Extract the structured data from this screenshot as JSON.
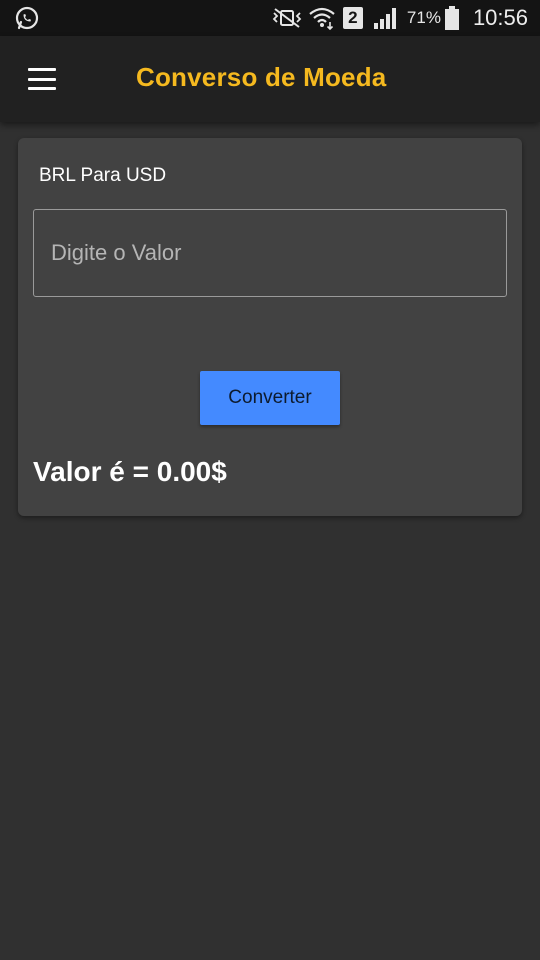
{
  "status_bar": {
    "left_icon": "whatsapp-icon",
    "icons": [
      "mute-vibrate-icon",
      "wifi-icon",
      "sim-2-icon",
      "signal-icon",
      "battery-icon"
    ],
    "sim_slot": "2",
    "battery_percent": "71%",
    "time": "10:56"
  },
  "app_bar": {
    "menu_icon": "hamburger-menu-icon",
    "title": "Converso de Moeda"
  },
  "card": {
    "title": "BRL Para USD",
    "input_placeholder": "Digite o Valor",
    "input_value": "",
    "button_label": "Converter",
    "result_text": "Valor é = 0.00$"
  },
  "colors": {
    "background": "#303030",
    "status_bar": "#141414",
    "app_bar": "#212121",
    "title_accent": "#f5b91f",
    "card": "#424242",
    "button": "#448aff"
  }
}
